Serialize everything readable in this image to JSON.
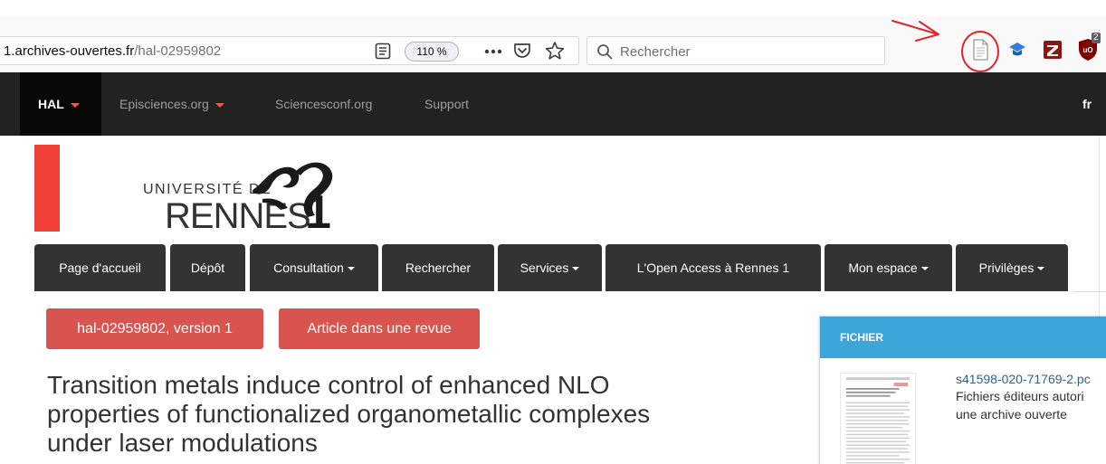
{
  "browser": {
    "url_domain": "1.archives-ouvertes.fr",
    "url_path": "/hal-02959802",
    "zoom_level": "110 %",
    "search_placeholder": "Rechercher",
    "extension_badge": "2",
    "icons": {
      "reader": "reader-view-icon",
      "more": "more-actions-icon",
      "pocket": "pocket-icon",
      "star": "bookmark-star-icon",
      "search": "search-icon",
      "document_extension": "document-extension-icon",
      "blue_extension": "graduation-cap-icon",
      "zotero_extension": "zotero-icon",
      "ublock_extension": "ublock-shield-icon"
    },
    "annotation_color": "#e0262b"
  },
  "hal_nav": {
    "hal": "HAL",
    "episciences": "Episciences.org",
    "sciencesconf": "Sciencesconf.org",
    "support": "Support",
    "lang": "fr"
  },
  "logo": {
    "line1": "UNIVERSITÉ DE",
    "line2": "RENNES",
    "numeral": "1"
  },
  "main_menu": {
    "home": "Page d'accueil",
    "depot": "Dépôt",
    "consultation": "Consultation",
    "rechercher": "Rechercher",
    "services": "Services",
    "open_access": "L'Open Access à Rennes 1",
    "mon_espace": "Mon espace",
    "privileges": "Privilèges"
  },
  "labels": {
    "version": "hal-02959802, version 1",
    "doc_type": "Article dans une revue"
  },
  "article": {
    "title_line1": "Transition metals induce control of enhanced NLO",
    "title_line2": "properties of functionalized organometallic complexes",
    "title_line3": "under laser modulations"
  },
  "file_panel": {
    "header": "FICHIER",
    "file_name": "s41598-020-71769-2.pc",
    "desc_line1": "Fichiers éditeurs autori",
    "desc_line2": "une archive ouverte"
  },
  "colors": {
    "hal_nav_bg": "#222222",
    "menu_tab_bg": "#333333",
    "label_red": "#d9534f",
    "brand_red": "#ee4035",
    "panel_header_blue": "#3da6d8",
    "link_blue": "#2a6496"
  }
}
